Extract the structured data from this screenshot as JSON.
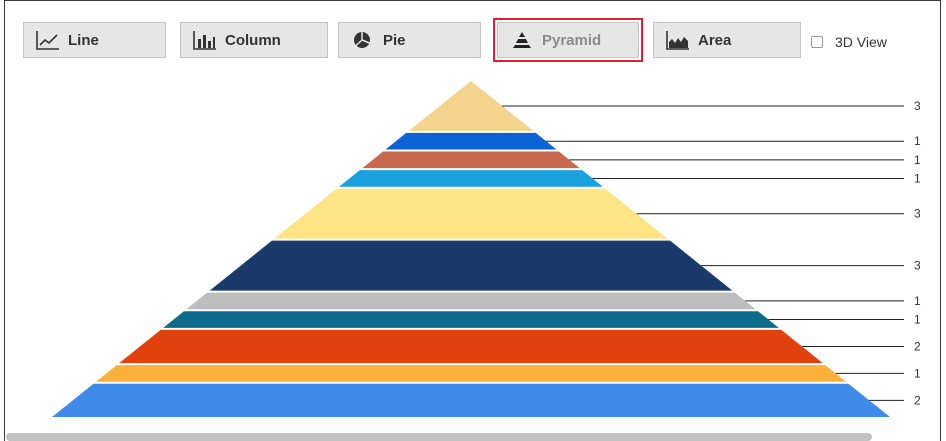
{
  "toolbar": {
    "buttons": [
      {
        "id": "line",
        "label": "Line",
        "icon": "line-chart-icon",
        "selected": false
      },
      {
        "id": "column",
        "label": "Column",
        "icon": "column-chart-icon",
        "selected": false
      },
      {
        "id": "pie",
        "label": "Pie",
        "icon": "pie-chart-icon",
        "selected": false
      },
      {
        "id": "pyramid",
        "label": "Pyramid",
        "icon": "pyramid-chart-icon",
        "selected": true
      },
      {
        "id": "area",
        "label": "Area",
        "icon": "area-chart-icon",
        "selected": false
      }
    ],
    "view3d_label": "3D View",
    "view3d_checked": false,
    "selected_outline_color": "#e0202a"
  },
  "chart_data": {
    "type": "pyramid",
    "segments": [
      {
        "value": 3,
        "color": "#f4d38d"
      },
      {
        "value": 1,
        "color": "#0b63d6"
      },
      {
        "value": 1,
        "color": "#c8694f"
      },
      {
        "value": 1,
        "color": "#1aa1df"
      },
      {
        "value": 3,
        "color": "#fde485"
      },
      {
        "value": 3,
        "color": "#1a3a6b"
      },
      {
        "value": 1,
        "color": "#bdbdbd"
      },
      {
        "value": 1,
        "color": "#0d6b8c"
      },
      {
        "value": 2,
        "color": "#e0410d"
      },
      {
        "value": 1,
        "color": "#fbb03b"
      },
      {
        "value": 2,
        "color": "#3f8ce8"
      }
    ],
    "data_labels": [
      "3",
      "1",
      "1",
      "1",
      "3",
      "3",
      "1",
      "1",
      "2",
      "1",
      "2"
    ]
  }
}
